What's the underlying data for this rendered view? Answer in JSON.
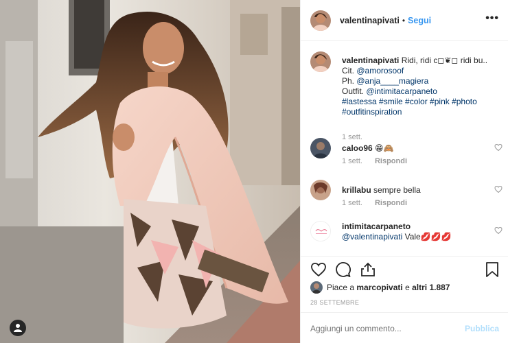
{
  "post": {
    "username": "valentinapivati",
    "separator": "•",
    "follow_label": "Segui",
    "more_label": "•••"
  },
  "caption": {
    "username": "valentinapivati",
    "text_line1": "Ridi, ridi c◻︎❦◻︎ ridi bu..",
    "cit_label": "Cit.",
    "cit_tag": "@amorosoof",
    "ph_label": "Ph.",
    "ph_tag": "@anja____magiera",
    "outfit_label": "Outfit.",
    "outfit_tag": "@intimitacarpaneto",
    "hashtags_line1": "#lastessa #smile #color #pink #photo",
    "hashtags_line2": "#outfitinspiration",
    "time": "1 sett."
  },
  "comments": [
    {
      "username": "caloo96",
      "text": "😁🙈",
      "time": "1 sett.",
      "reply": "Rispondi"
    },
    {
      "username": "krillabu",
      "text": "sempre bella",
      "time": "1 sett.",
      "reply": "Rispondi"
    },
    {
      "username": "intimitacarpaneto",
      "mention": "@valentinapivati",
      "text": "Vale💋💋💋"
    }
  ],
  "likes": {
    "prefix": "Piace a",
    "user": "marcopivati",
    "middle": "e",
    "others": "altri 1.887"
  },
  "date": "28 SETTEMBRE",
  "add_comment": {
    "placeholder": "Aggiungi un commento...",
    "publish_label": "Pubblica"
  },
  "icons": [
    "user-tag-icon",
    "heart-icon",
    "comment-icon",
    "share-icon",
    "bookmark-icon"
  ],
  "colors": {
    "accent": "#3897f0",
    "muted": "#999999",
    "tag": "#003569",
    "publish_disabled": "#b2dffc"
  }
}
